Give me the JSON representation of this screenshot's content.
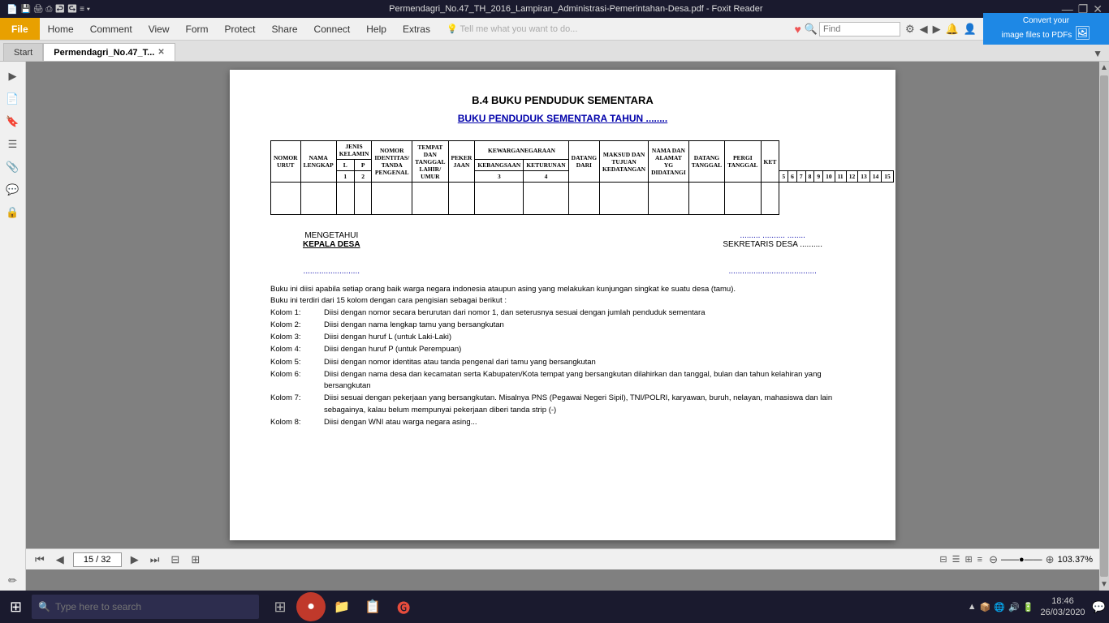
{
  "titlebar": {
    "title": "Permendagri_No.47_TH_2016_Lampiran_Administrasi-Pemerintahan-Desa.pdf - Foxit Reader",
    "min": "—",
    "max": "❐",
    "close": "✕"
  },
  "menubar": {
    "file": "File",
    "items": [
      "Home",
      "Comment",
      "View",
      "Form",
      "Protect",
      "Share",
      "Connect",
      "Help",
      "Extras"
    ],
    "search_placeholder": "Tell me what you want to do...",
    "heart_icon": "♥",
    "find_placeholder": "Find"
  },
  "convert_banner": {
    "line1": "Convert your",
    "line2": "image files to PDFs"
  },
  "tabs": {
    "items": [
      {
        "label": "Start",
        "closable": false
      },
      {
        "label": "Permendagri_No.47_T...",
        "closable": true
      }
    ]
  },
  "pdf": {
    "title_main": "B.4 BUKU PENDUDUK SEMENTARA",
    "title_sub": "BUKU PENDUDUK SEMENTARA TAHUN ........",
    "table": {
      "headers_row1": [
        {
          "text": "NOMOR URUT",
          "rowspan": 2,
          "colspan": 1
        },
        {
          "text": "NAMA LENGKAP",
          "rowspan": 2,
          "colspan": 1
        },
        {
          "text": "JENIS KELAMIN",
          "rowspan": 1,
          "colspan": 2
        },
        {
          "text": "NOMOR IDENTITAS/ TANDA PENGENAL",
          "rowspan": 2,
          "colspan": 1
        },
        {
          "text": "TEMPAT DAN TANGGAL LAHIR/ UMUR",
          "rowspan": 2,
          "colspan": 1
        },
        {
          "text": "PEKER JAAN",
          "rowspan": 2,
          "colspan": 1
        },
        {
          "text": "KEWARGANEGARAAN",
          "rowspan": 1,
          "colspan": 2
        },
        {
          "text": "DATANG DARI",
          "rowspan": 2,
          "colspan": 1
        },
        {
          "text": "MAKSUD DAN TUJUAN KEDATANGAN",
          "rowspan": 2,
          "colspan": 1
        },
        {
          "text": "NAMA DAN ALAMAT YG DIDATANGI",
          "rowspan": 2,
          "colspan": 1
        },
        {
          "text": "DATANG TANGGAL",
          "rowspan": 2,
          "colspan": 1
        },
        {
          "text": "PERGI TANGGAL",
          "rowspan": 2,
          "colspan": 1
        },
        {
          "text": "KET",
          "rowspan": 2,
          "colspan": 1
        }
      ],
      "headers_row2": [
        "L",
        "P",
        "KEBANGSAAN",
        "KETURUNAN"
      ],
      "col_numbers": [
        "1",
        "2",
        "3",
        "4",
        "5",
        "6",
        "7",
        "8",
        "9",
        "10",
        "11",
        "12",
        "13",
        "14",
        "15"
      ]
    },
    "signatures": {
      "left_title": "MENGETAHUI",
      "left_sub": "KEPALA DESA",
      "right_dots": "......... .......... ........",
      "right_title": "SEKRETARIS DESA ..........",
      "left_name_dots": ".........................",
      "right_name_dots": "......................................."
    },
    "description": {
      "intro1": "Buku ini diisi apabila setiap orang baik warga negara indonesia ataupun asing yang melakukan kunjungan singkat ke suatu desa (tamu).",
      "intro2": "Buku ini terdiri dari 15 kolom dengan cara pengisian sebagai berikut :",
      "columns": [
        {
          "label": "Kolom 1:",
          "text": "Diisi dengan nomor secara berurutan dari nomor 1, dan seterusnya sesuai dengan jumlah penduduk sementara"
        },
        {
          "label": "Kolom 2:",
          "text": "Diisi dengan nama lengkap tamu yang bersangkutan"
        },
        {
          "label": "Kolom 3:",
          "text": "Diisi dengan huruf L (untuk Laki-Laki)"
        },
        {
          "label": "Kolom 4:",
          "text": "Diisi dengan huruf P (untuk Perempuan)"
        },
        {
          "label": "Kolom 5:",
          "text": "Diisi dengan nomor identitas atau tanda pengenal dari tamu yang bersangkutan"
        },
        {
          "label": "Kolom 6:",
          "text": "Diisi dengan nama desa dan kecamatan serta Kabupaten/Kota tempat yang bersangkutan dilahirkan dan tanggal, bulan dan tahun kelahiran yang bersangkutan"
        },
        {
          "label": "Kolom 7:",
          "text": "Diisi sesuai dengan pekerjaan yang bersangkutan. Misalnya PNS (Pegawai Negeri Sipil), TNI/POLRI, karyawan, buruh, nelayan, mahasiswa dan lain sebagainya, kalau belum mempunyai pekerjaan diberi tanda strip (-)"
        },
        {
          "label": "Kolom 8:",
          "text": "Diisi dengan WNI atau warga negara asing..."
        }
      ]
    }
  },
  "bottombar": {
    "page_current": "15",
    "page_total": "32",
    "zoom": "103.37%"
  },
  "taskbar": {
    "search_placeholder": "Type here to search",
    "time": "18:46",
    "date": "26/03/2020",
    "apps": [
      "⊞",
      "🔍",
      "⊟",
      "🟧",
      "📁",
      "📋"
    ]
  }
}
